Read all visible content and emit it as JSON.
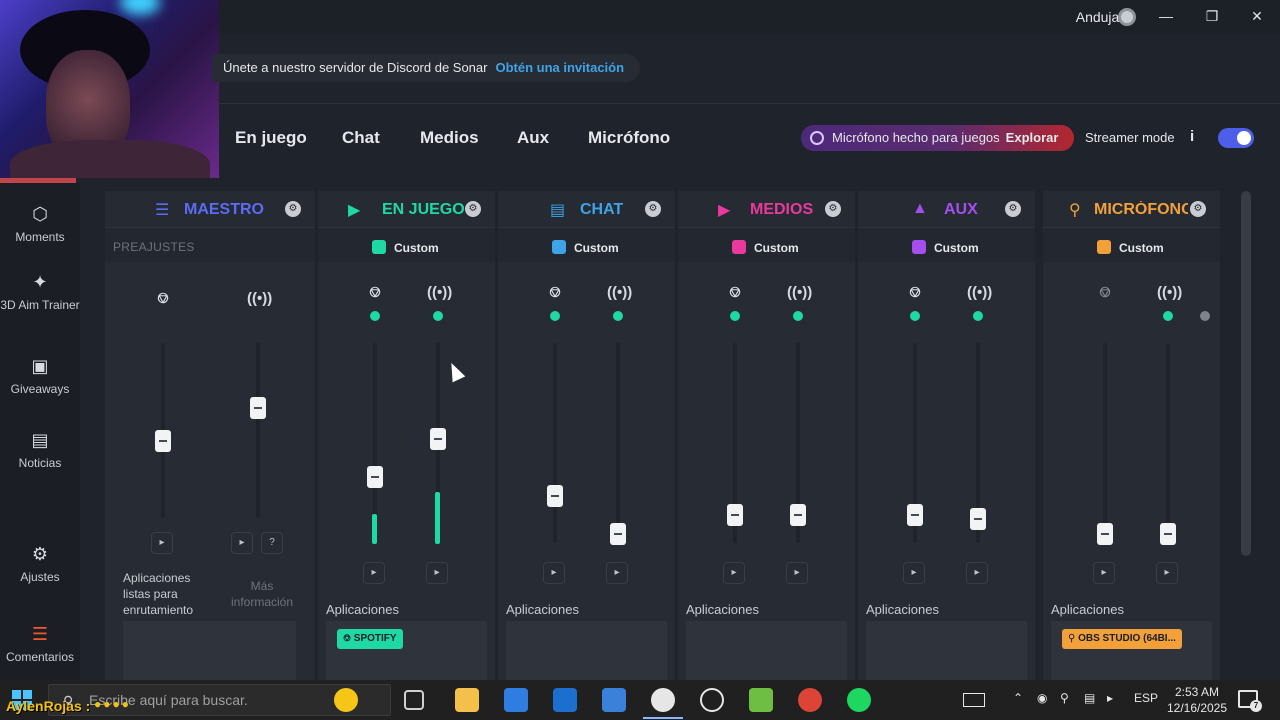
{
  "titlebar": {
    "user_name": "Andujar",
    "window_buttons": [
      "minimize-icon",
      "restore-icon",
      "close-icon"
    ]
  },
  "banner": {
    "text": "Únete a nuestro servidor de Discord de Sonar",
    "link": "Obtén una invitación"
  },
  "tabs": [
    "En juego",
    "Chat",
    "Medios",
    "Aux",
    "Micrófono"
  ],
  "promo": {
    "text": "Micrófono hecho para juegos",
    "action": "Explorar"
  },
  "streamer_mode": {
    "label": "Streamer mode",
    "info": "i",
    "enabled": true
  },
  "sidebar": {
    "items": [
      {
        "label": "Moments",
        "icon": "hexagon-icon"
      },
      {
        "label": "3D Aim Trainer",
        "icon": "target-icon"
      },
      {
        "label": "Giveaways",
        "icon": "gift-icon"
      },
      {
        "label": "Noticias",
        "icon": "book-icon"
      },
      {
        "label": "Ajustes",
        "icon": "gear-icon"
      },
      {
        "label": "Comentarios",
        "icon": "feedback-icon"
      }
    ]
  },
  "mixer": {
    "master": {
      "title": "MAESTRO",
      "preajustes": "PREAJUSTES",
      "apps_note": "Aplicaciones listas para enrutamiento",
      "more_info": "Más información",
      "color": "#5b6cf5"
    },
    "channels": [
      {
        "title": "EN JUEGO",
        "preset": "Custom",
        "color": "#1ed9a4",
        "apps_label": "Aplicaciones",
        "apps": [
          "SPOTIFY"
        ],
        "app_color": "#1ed9a4"
      },
      {
        "title": "CHAT",
        "preset": "Custom",
        "color": "#3fa3e8",
        "apps_label": "Aplicaciones",
        "apps": []
      },
      {
        "title": "MEDIOS",
        "preset": "Custom",
        "color": "#e83a9c",
        "apps_label": "Aplicaciones",
        "apps": []
      },
      {
        "title": "AUX",
        "preset": "Custom",
        "color": "#a44ef0",
        "apps_label": "Aplicaciones",
        "apps": []
      },
      {
        "title": "MICRÓFONO",
        "preset": "Custom",
        "color": "#f2a03a",
        "apps_label": "Aplicaciones",
        "apps": [
          "OBS STUDIO (64BI..."
        ],
        "app_color": "#f2a03a"
      }
    ]
  },
  "taskbar": {
    "overlay_name": "AylenRojas :",
    "search_placeholder": "Escribe aquí para buscar.",
    "language": "ESP",
    "time": "2:53 AM",
    "date": "12/16/2025",
    "notifications": "7"
  }
}
